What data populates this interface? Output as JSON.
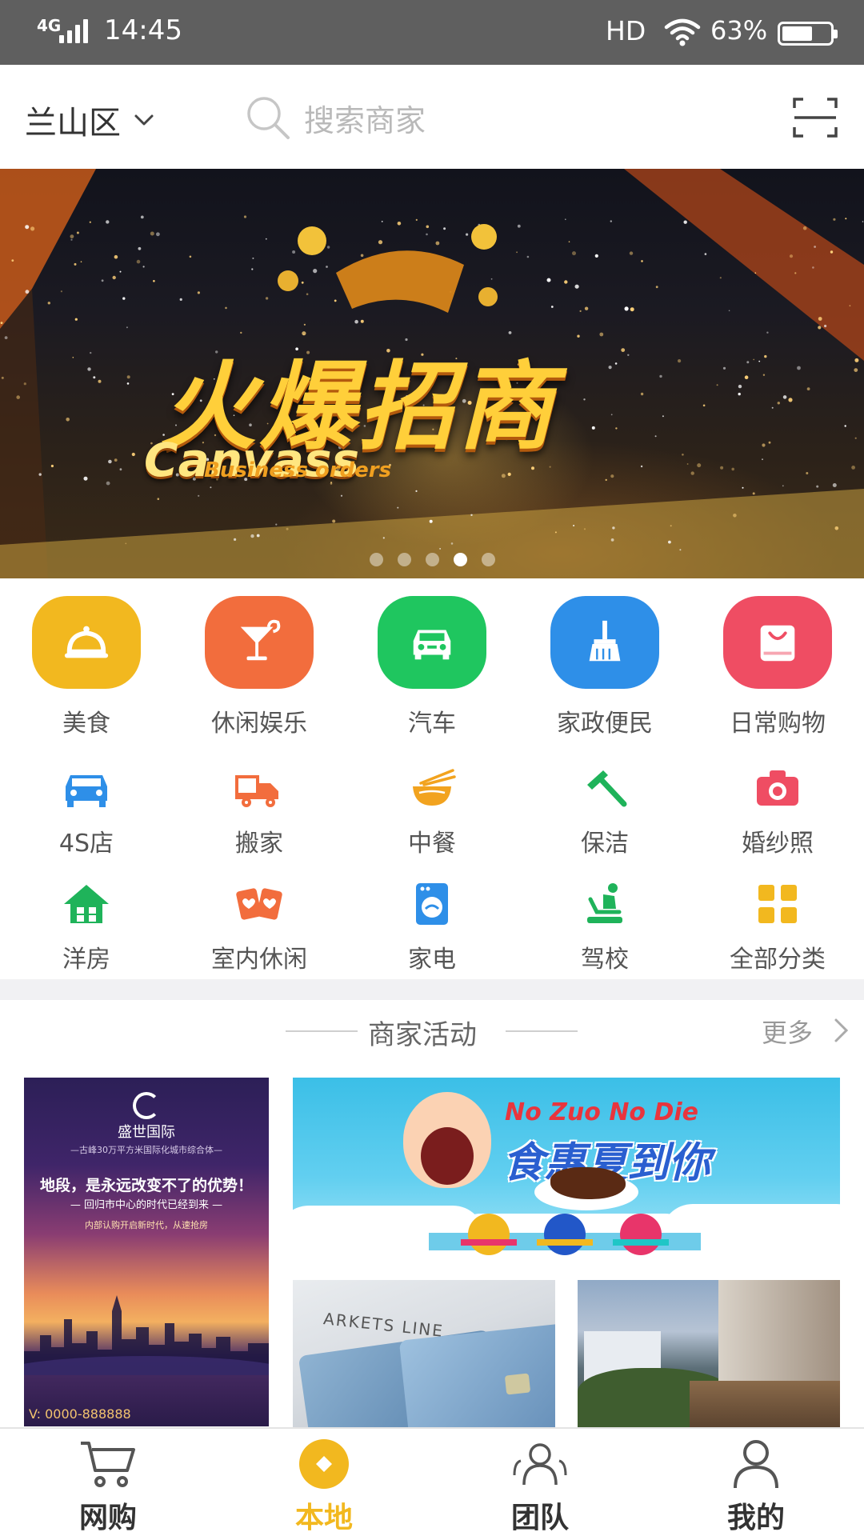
{
  "status_bar": {
    "network": "4G",
    "time": "14:45",
    "hd": "HD",
    "battery_percent": "63%",
    "battery_level": 0.63
  },
  "header": {
    "district": "兰山区",
    "search_placeholder": "搜索商家"
  },
  "banner": {
    "title_cn": "火爆招商",
    "title_en": "Canvass",
    "subtitle_en": "Business orders",
    "slide_count": 5,
    "active_slide": 4
  },
  "categories_main": [
    {
      "label": "美食",
      "icon": "food-cloche-icon",
      "color": "#f2b81f"
    },
    {
      "label": "休闲娱乐",
      "icon": "cocktail-icon",
      "color": "#f26d3d"
    },
    {
      "label": "汽车",
      "icon": "car-icon",
      "color": "#1fc65f"
    },
    {
      "label": "家政便民",
      "icon": "broom-icon",
      "color": "#2e8fe8"
    },
    {
      "label": "日常购物",
      "icon": "shopping-bag-icon",
      "color": "#ef4d63"
    }
  ],
  "categories_small": [
    {
      "label": "4S店",
      "icon": "car-service-icon",
      "color": "#2e8fe8"
    },
    {
      "label": "搬家",
      "icon": "moving-truck-icon",
      "color": "#f26d3d"
    },
    {
      "label": "中餐",
      "icon": "noodle-bowl-icon",
      "color": "#f2a31f"
    },
    {
      "label": "保洁",
      "icon": "squeegee-icon",
      "color": "#1fb35a"
    },
    {
      "label": "婚纱照",
      "icon": "camera-icon",
      "color": "#ef4d63"
    },
    {
      "label": "洋房",
      "icon": "house-icon",
      "color": "#1fb35a"
    },
    {
      "label": "室内休闲",
      "icon": "playing-cards-icon",
      "color": "#f26d3d"
    },
    {
      "label": "家电",
      "icon": "washing-machine-icon",
      "color": "#2e8fe8"
    },
    {
      "label": "驾校",
      "icon": "driving-school-icon",
      "color": "#1fb35a"
    },
    {
      "label": "全部分类",
      "icon": "all-categories-icon",
      "color": "#f2b81f"
    }
  ],
  "activities": {
    "title": "商家活动",
    "more": "更多",
    "poster_realestate": {
      "brand": "盛世国际",
      "tagline": "—古峰30万平方米国际化城市综合体—",
      "headline": "地段，是永远改变不了的优势！",
      "sub": "— 回归市中心的时代已经到来 —",
      "note": "内部认购开启新时代，从速抢房",
      "phone": "V: 0000-888888"
    },
    "poster_food": {
      "slogan_en": "No Zuo No Die",
      "slogan_cn": "食惠夏到你"
    },
    "poster_cards": {
      "paper_text": "ARKETS LINE"
    }
  },
  "bottom_nav": [
    {
      "label": "网购",
      "icon": "cart-icon",
      "active": false
    },
    {
      "label": "本地",
      "icon": "local-diamond-icon",
      "active": true
    },
    {
      "label": "团队",
      "icon": "team-icon",
      "active": false
    },
    {
      "label": "我的",
      "icon": "profile-icon",
      "active": false
    }
  ],
  "colors": {
    "accent": "#f2b81f",
    "status_bar": "#5f5f5f"
  }
}
